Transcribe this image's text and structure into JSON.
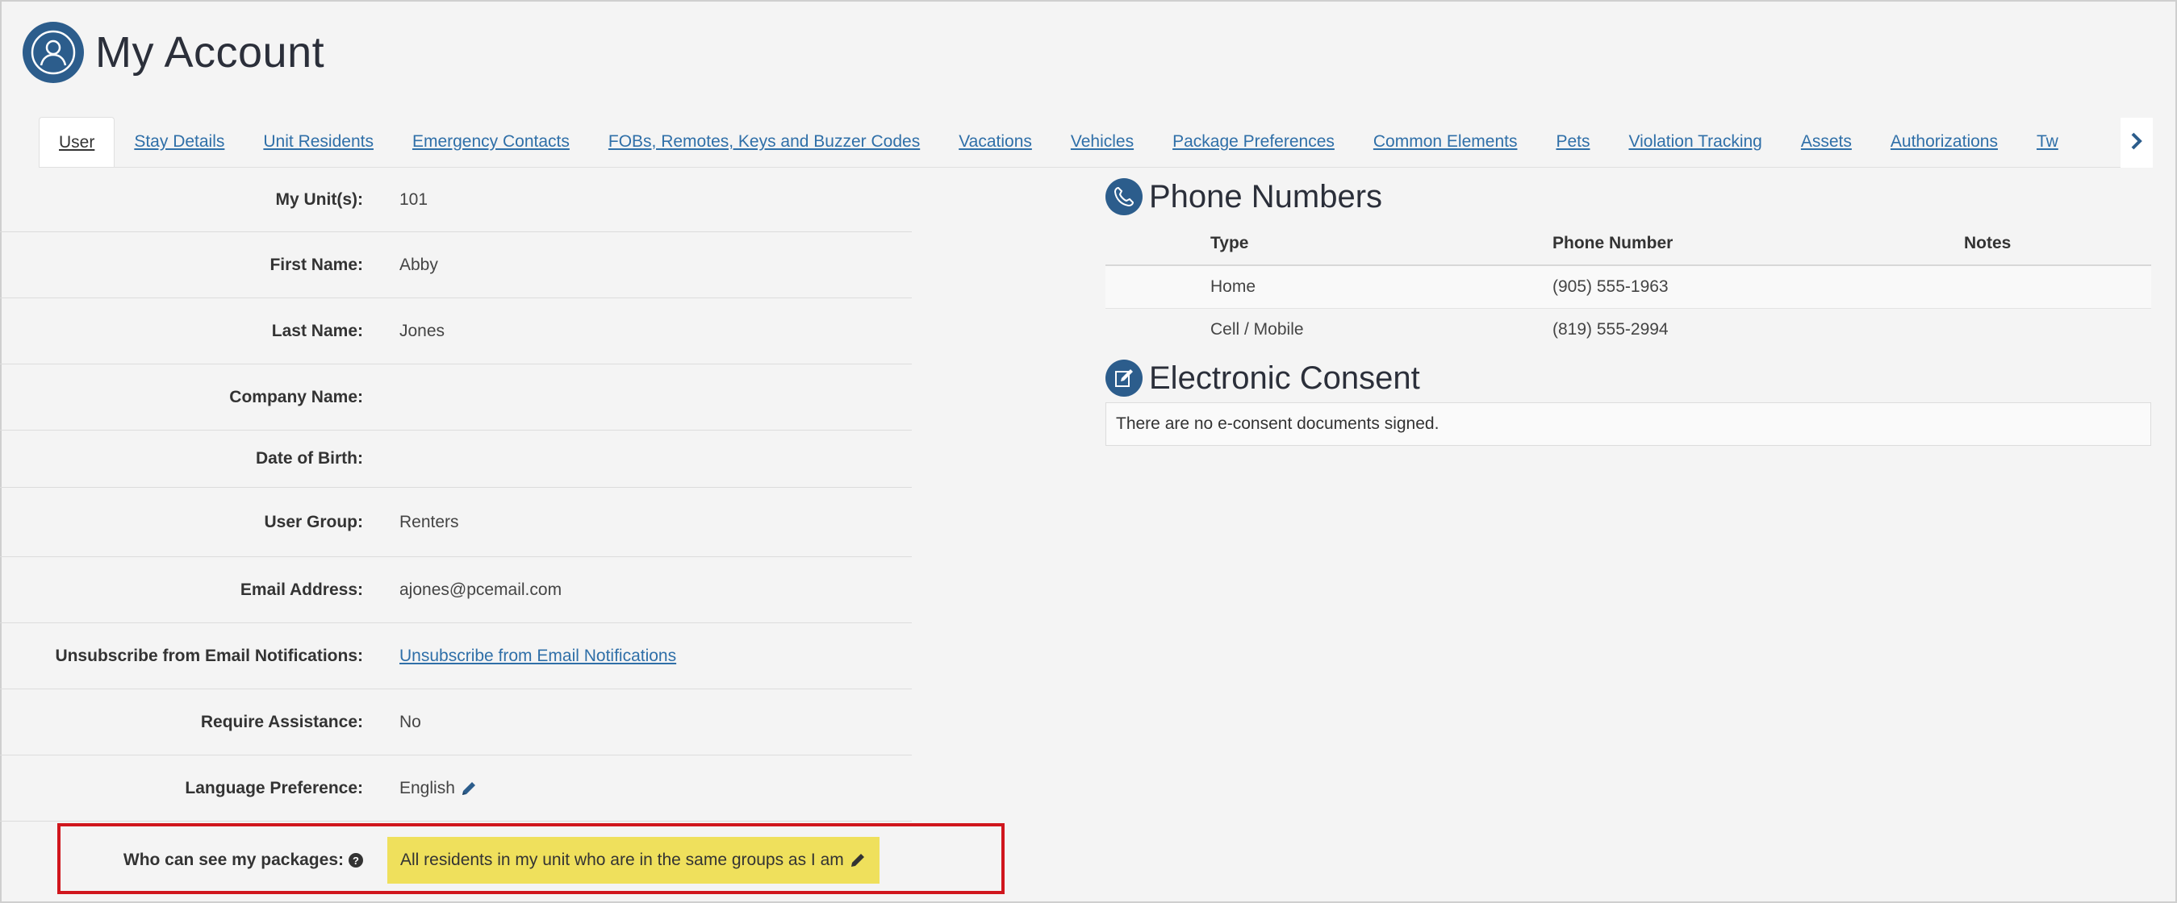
{
  "header": {
    "title": "My Account",
    "icon": "user-profile-icon",
    "accent_color": "#2c5d8c"
  },
  "tabs": [
    {
      "label": "User",
      "active": true
    },
    {
      "label": "Stay Details"
    },
    {
      "label": "Unit Residents"
    },
    {
      "label": "Emergency Contacts"
    },
    {
      "label": "FOBs, Remotes, Keys and Buzzer Codes"
    },
    {
      "label": "Vacations"
    },
    {
      "label": "Vehicles"
    },
    {
      "label": "Package Preferences"
    },
    {
      "label": "Common Elements"
    },
    {
      "label": "Pets"
    },
    {
      "label": "Violation Tracking"
    },
    {
      "label": "Assets"
    },
    {
      "label": "Authorizations"
    },
    {
      "label": "Tw"
    }
  ],
  "details": {
    "unit_label": "My Unit(s):",
    "unit_value": "101",
    "first_name_label": "First Name:",
    "first_name_value": "Abby",
    "last_name_label": "Last Name:",
    "last_name_value": "Jones",
    "company_label": "Company Name:",
    "company_value": "",
    "dob_label": "Date of Birth:",
    "dob_value": "",
    "group_label": "User Group:",
    "group_value": "Renters",
    "email_label": "Email Address:",
    "email_value": "ajones@pcemail.com",
    "unsub_label": "Unsubscribe from Email Notifications:",
    "unsub_link": "Unsubscribe from Email Notifications",
    "assist_label": "Require Assistance:",
    "assist_value": "No",
    "lang_label": "Language Preference:",
    "lang_value": "English",
    "packages_label": "Who can see my packages:",
    "packages_value": "All residents in my unit who are in the same groups as I am"
  },
  "phones": {
    "title": "Phone Numbers",
    "headers": [
      "Type",
      "Phone Number",
      "Notes"
    ],
    "rows": [
      {
        "type": "Home",
        "number": "(905) 555-1963",
        "notes": ""
      },
      {
        "type": "Cell / Mobile",
        "number": "(819) 555-2994",
        "notes": ""
      }
    ]
  },
  "consent": {
    "title": "Electronic Consent",
    "message": "There are no e-consent documents signed."
  },
  "colors": {
    "link": "#2f6fa8",
    "highlight_bg": "#efe05c",
    "highlight_border": "#d0161d"
  }
}
